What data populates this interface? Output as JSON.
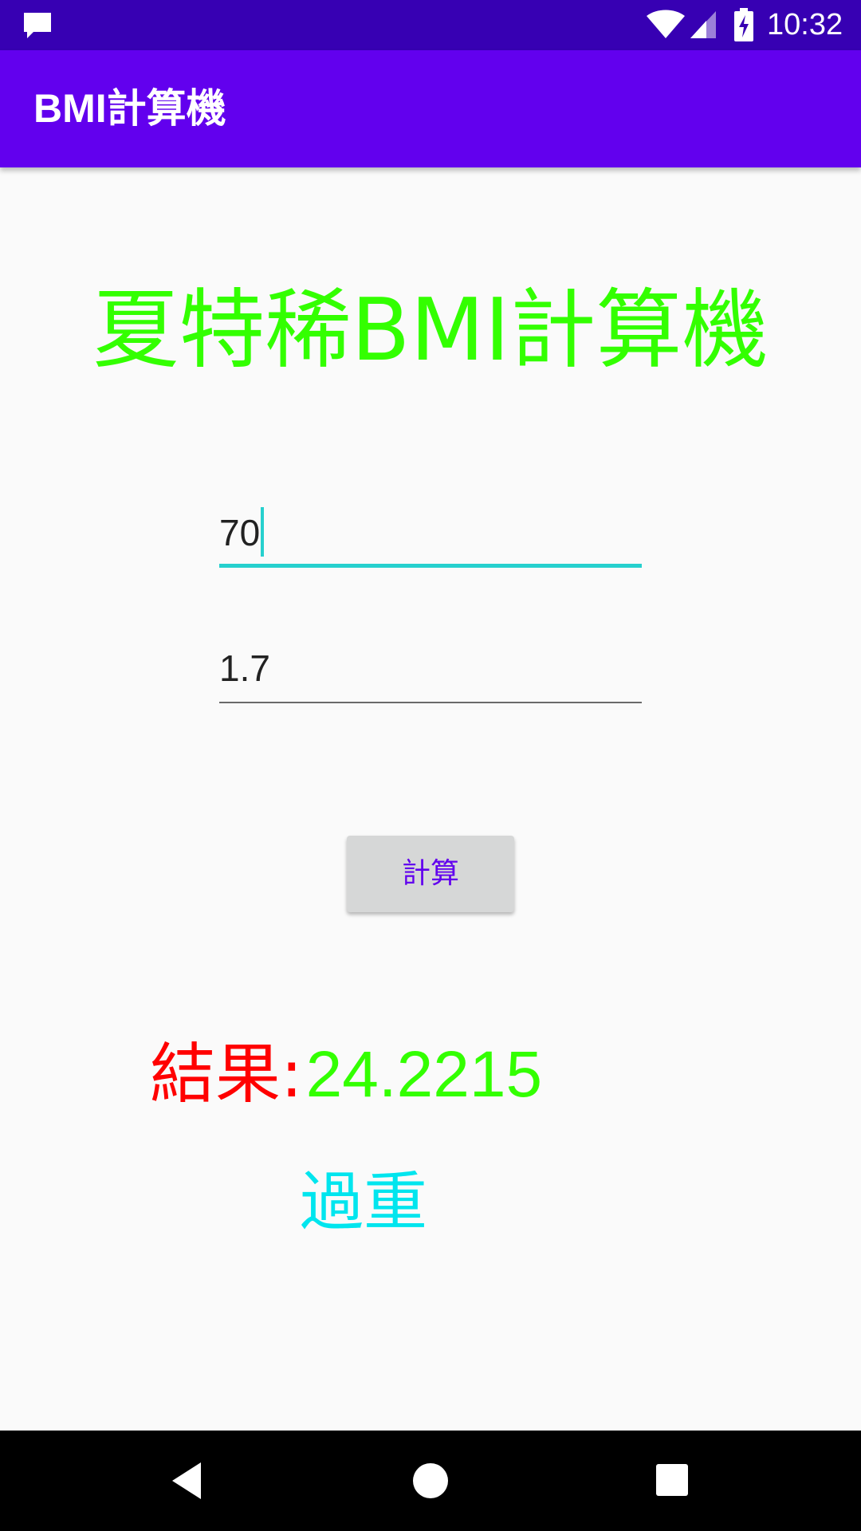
{
  "status_bar": {
    "time": "10:32",
    "icons": [
      "notification-icon",
      "wifi-icon",
      "signal-icon",
      "battery-charging-icon"
    ]
  },
  "app_bar": {
    "title": "BMI計算機"
  },
  "main": {
    "heading": "夏特稀BMI計算機",
    "weight_input": {
      "value": "70"
    },
    "height_input": {
      "value": "1.7"
    },
    "calculate_button": "計算",
    "result_label": "結果:",
    "result_value": "24.2215",
    "result_status": "過重"
  },
  "colors": {
    "status_bar": "#3700b3",
    "app_bar": "#6200ee",
    "heading": "#33ff00",
    "result_label": "#ff0000",
    "result_value": "#33ff00",
    "result_status": "#00e5ee",
    "input_focus": "#26d0ce"
  },
  "nav_bar": {
    "icons": [
      "back-icon",
      "home-icon",
      "recents-icon"
    ]
  }
}
